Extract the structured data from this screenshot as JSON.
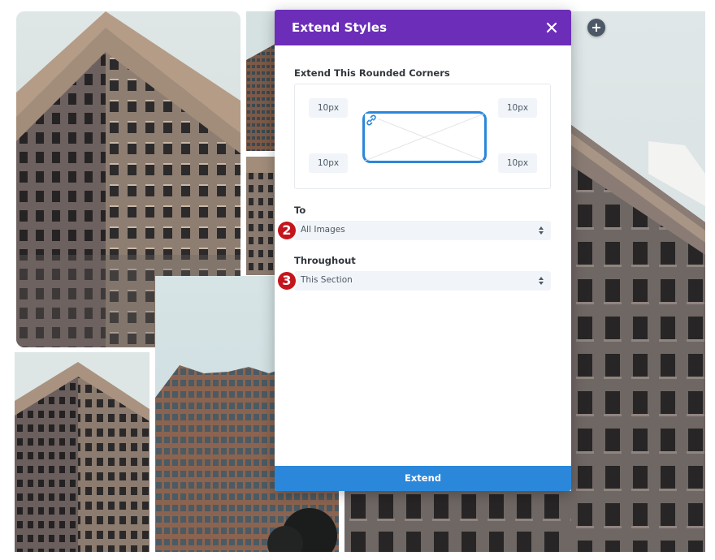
{
  "modal": {
    "title": "Extend Styles",
    "extend_label": "Extend This Rounded Corners",
    "corners": {
      "top_left": "10px",
      "top_right": "10px",
      "bottom_left": "10px",
      "bottom_right": "10px"
    },
    "to": {
      "label": "To",
      "value": "All Images",
      "step": "2"
    },
    "throughout": {
      "label": "Throughout",
      "value": "This Section",
      "step": "3"
    },
    "extend_button": "Extend"
  },
  "colors": {
    "header_purple": "#6c2eb9",
    "accent_blue": "#2b87da",
    "badge_red": "#c4151c",
    "add_button_gray": "#4c5866"
  },
  "icons": {
    "close": "close-icon",
    "link": "link-icon",
    "select_arrows": "updown-arrows-icon",
    "add": "plus-icon"
  }
}
